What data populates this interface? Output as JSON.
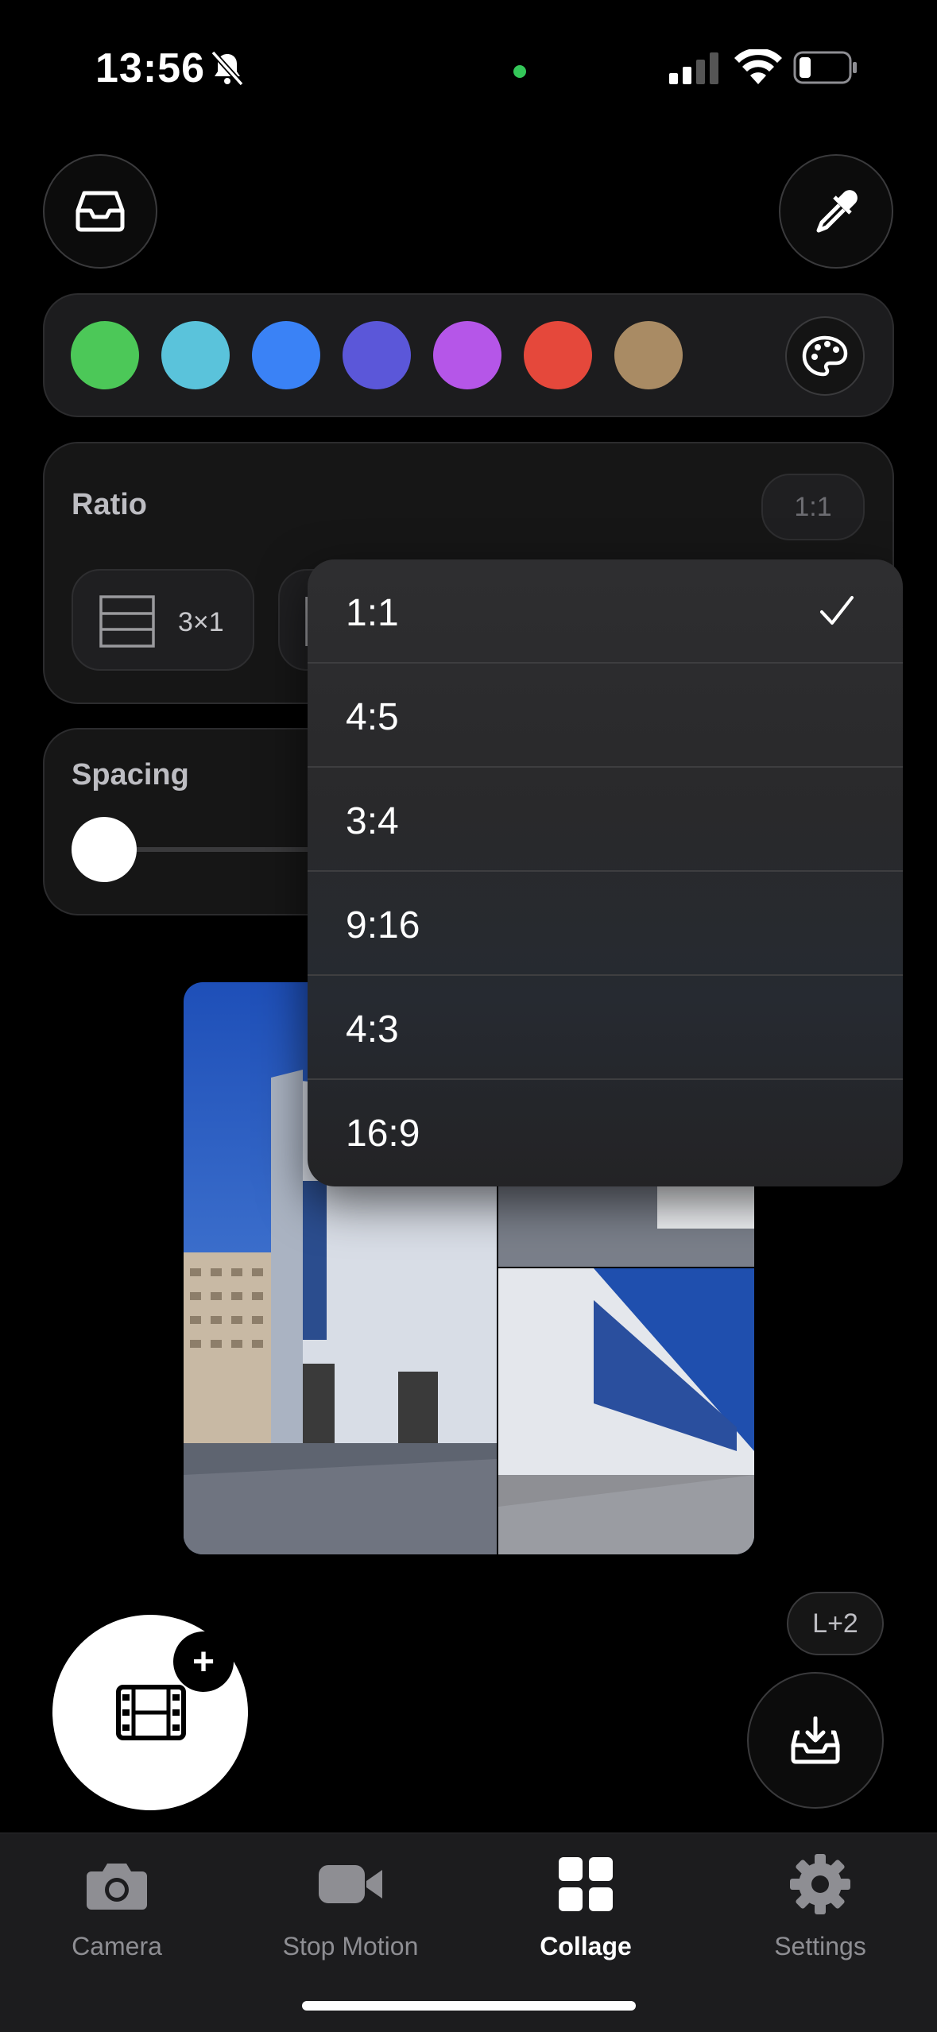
{
  "status_bar": {
    "time": "13:56"
  },
  "colors": {
    "swatches": [
      "#4cc858",
      "#5ac3db",
      "#3a82f6",
      "#5b57d9",
      "#b556e8",
      "#e5483b",
      "#a98b64"
    ],
    "accent_green": "#34c759"
  },
  "ratio": {
    "label": "Ratio",
    "current": "1:1",
    "layout_option": "3×1"
  },
  "spacing": {
    "label": "Spacing",
    "value": 0
  },
  "ratio_menu": {
    "items": [
      "1:1",
      "4:5",
      "3:4",
      "9:16",
      "4:3",
      "16:9"
    ],
    "selected": "1:1"
  },
  "badge": {
    "text": "L+2"
  },
  "tabs": [
    {
      "label": "Camera",
      "icon": "camera-icon"
    },
    {
      "label": "Stop Motion",
      "icon": "video-camera-icon"
    },
    {
      "label": "Collage",
      "icon": "grid-icon",
      "active": true
    },
    {
      "label": "Settings",
      "icon": "gear-icon"
    }
  ]
}
